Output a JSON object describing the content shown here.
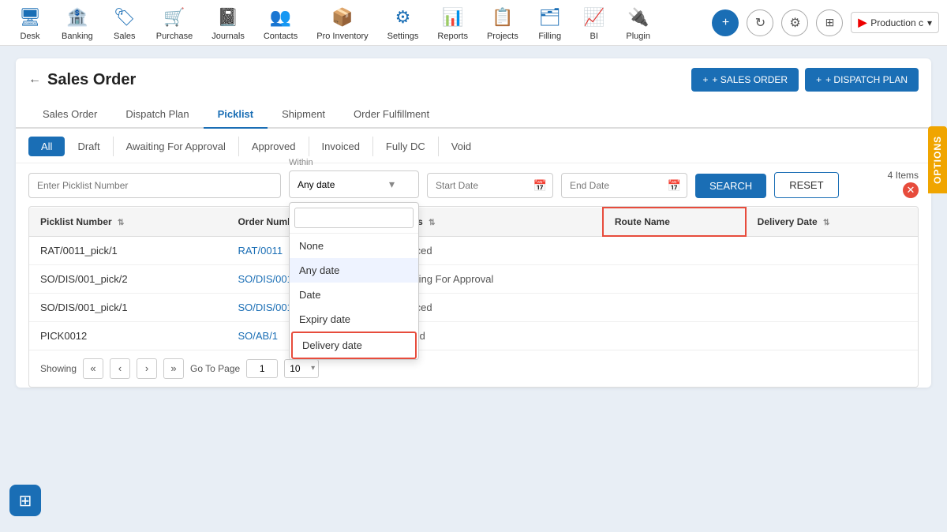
{
  "nav": {
    "items": [
      {
        "label": "Desk",
        "icon": "🖥"
      },
      {
        "label": "Banking",
        "icon": "🏦"
      },
      {
        "label": "Sales",
        "icon": "🏷"
      },
      {
        "label": "Purchase",
        "icon": "🛒"
      },
      {
        "label": "Journals",
        "icon": "📓"
      },
      {
        "label": "Contacts",
        "icon": "👥"
      },
      {
        "label": "Pro Inventory",
        "icon": "📦"
      },
      {
        "label": "Settings",
        "icon": "⚙"
      },
      {
        "label": "Reports",
        "icon": "📊"
      },
      {
        "label": "Projects",
        "icon": "📋"
      },
      {
        "label": "Filling",
        "icon": "🗂"
      },
      {
        "label": "BI",
        "icon": "📈"
      },
      {
        "label": "Plugin",
        "icon": "🔌"
      }
    ],
    "production_label": "Production c"
  },
  "page": {
    "title": "Sales Order",
    "back_label": "←",
    "btn_sales_order": "+ SALES ORDER",
    "btn_dispatch_plan": "+ DISPATCH PLAN"
  },
  "tabs": [
    {
      "label": "Sales Order"
    },
    {
      "label": "Dispatch Plan"
    },
    {
      "label": "Picklist"
    },
    {
      "label": "Shipment"
    },
    {
      "label": "Order Fulfillment"
    }
  ],
  "active_tab": "Picklist",
  "filter_tabs": [
    {
      "label": "All"
    },
    {
      "label": "Draft"
    },
    {
      "label": "Awaiting For Approval"
    },
    {
      "label": "Approved"
    },
    {
      "label": "Invoiced"
    },
    {
      "label": "Fully DC"
    },
    {
      "label": "Void"
    }
  ],
  "active_filter": "All",
  "search": {
    "picklist_placeholder": "Enter Picklist Number",
    "within_label": "Within",
    "within_value": "Any date",
    "start_date_placeholder": "Start Date",
    "end_date_placeholder": "End Date",
    "btn_search": "SEARCH",
    "btn_reset": "RESET",
    "items_count": "4 Items"
  },
  "within_dropdown": {
    "search_placeholder": "",
    "items": [
      {
        "label": "None",
        "selected": false
      },
      {
        "label": "Any date",
        "selected": true
      },
      {
        "label": "Date",
        "selected": false
      },
      {
        "label": "Expiry date",
        "selected": false
      },
      {
        "label": "Delivery date",
        "selected": false,
        "highlighted": true
      }
    ]
  },
  "table": {
    "columns": [
      {
        "label": "Picklist Number",
        "sortable": true
      },
      {
        "label": "Order Number",
        "sortable": false
      },
      {
        "label": "Status",
        "sortable": true
      },
      {
        "label": "Route Name",
        "sortable": false,
        "highlighted": true
      },
      {
        "label": "Delivery Date",
        "sortable": true
      }
    ],
    "rows": [
      {
        "picklist_number": "RAT/0011_pick/1",
        "order_number": "RAT/0011",
        "status": "Invoiced",
        "route_name": "",
        "delivery_date": ""
      },
      {
        "picklist_number": "SO/DIS/001_pick/2",
        "order_number": "SO/DIS/001",
        "status": "Awaiting For Approval",
        "route_name": "",
        "delivery_date": ""
      },
      {
        "picklist_number": "SO/DIS/001_pick/1",
        "order_number": "SO/DIS/001",
        "status": "Invoiced",
        "route_name": "",
        "delivery_date": ""
      },
      {
        "picklist_number": "PICK0012",
        "order_number": "SO/AB/1",
        "status": "Voided",
        "route_name": "",
        "delivery_date": ""
      }
    ]
  },
  "pagination": {
    "showing_text": "Showing",
    "page_num": "1",
    "per_page": "10",
    "go_to_page_label": "Go To Page"
  },
  "options_label": "OPTIONS",
  "grid_icon": "⊞"
}
